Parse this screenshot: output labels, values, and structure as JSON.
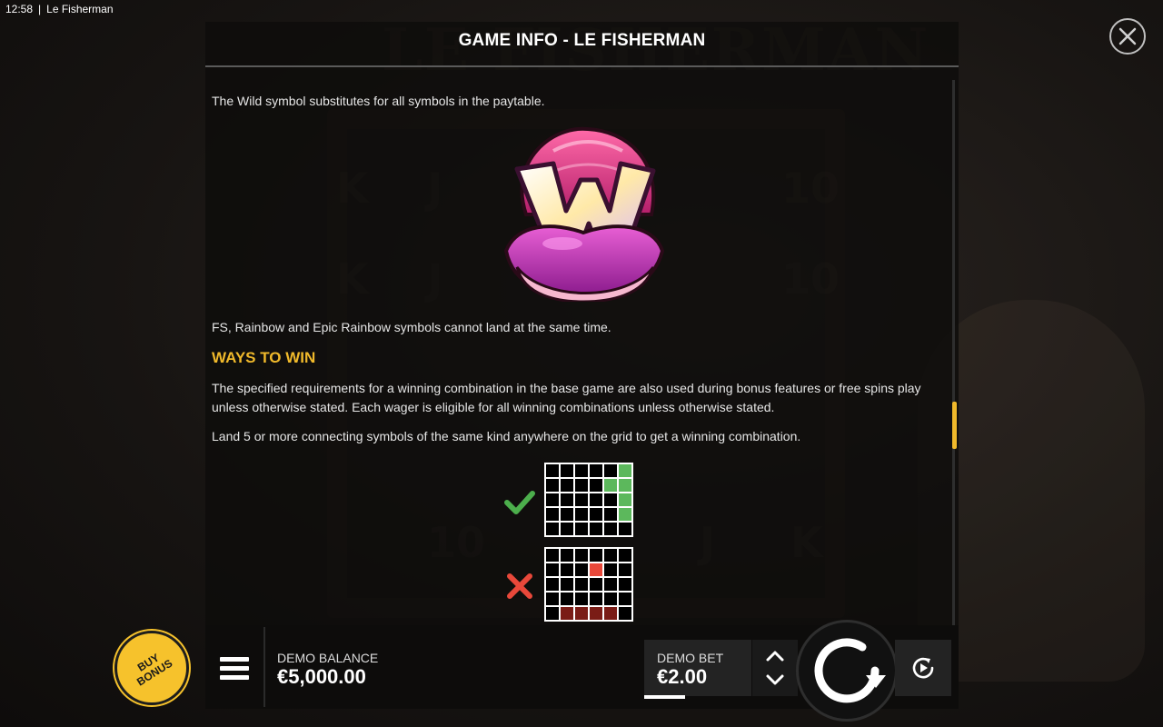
{
  "status_bar": {
    "time": "12:58",
    "separator": "|",
    "app_title": "Le Fisherman"
  },
  "panel": {
    "title": "GAME INFO - LE FISHERMAN",
    "wild_text": "The Wild symbol substitutes for all symbols in the paytable.",
    "wild_symbol_icon": "wild-clam-icon",
    "fs_text": "FS, Rainbow and Epic Rainbow symbols cannot land at the same time.",
    "ways_heading": "WAYS TO WIN",
    "ways_text": "The specified requirements for a winning combination in the base game are also used during bonus features or free spins play unless otherwise stated. Each wager is eligible for all winning combinations unless otherwise stated.",
    "connect_text": "Land 5 or more connecting symbols of the same kind anywhere on the grid to get a winning combination.",
    "valid_example_icon": "checkmark-icon",
    "invalid_example_icon": "cross-icon"
  },
  "bottom_bar": {
    "buy_bonus_label": "BUY BONUS",
    "balance_label": "DEMO BALANCE",
    "balance_value": "€5,000.00",
    "bet_label": "DEMO BET",
    "bet_value": "€2.00"
  },
  "colors": {
    "accent": "#f0b92b",
    "buy_bonus": "#f6c22c",
    "win_cell": "#5cb85c",
    "lose_cell": "#e8483a"
  }
}
